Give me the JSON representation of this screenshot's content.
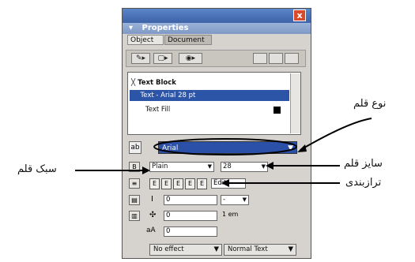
{
  "panel": {
    "title": "Properties",
    "close_glyph": "x",
    "tabs": [
      "Object",
      "Document"
    ],
    "list_items": [
      "Text Block",
      "Text - Arial 28 pt",
      "Text Fill"
    ],
    "font_name": "Arial",
    "style_value": "Plain",
    "size_value": "28",
    "align_buttons": [
      "E",
      "E",
      "E",
      "E",
      "E"
    ],
    "edit_label": "Edit",
    "unit_label": "1 em",
    "bottom_left": "No effect",
    "bottom_right": "Normal Text"
  },
  "annotations": {
    "font_type": "نوع قلم",
    "font_size": "سایز قلم",
    "alignment": "ترازبندی",
    "font_style": "سبک قلم"
  },
  "colors": {
    "selection": "#2d55a7",
    "title": "#3d62a8",
    "close": "#d94a2a"
  }
}
